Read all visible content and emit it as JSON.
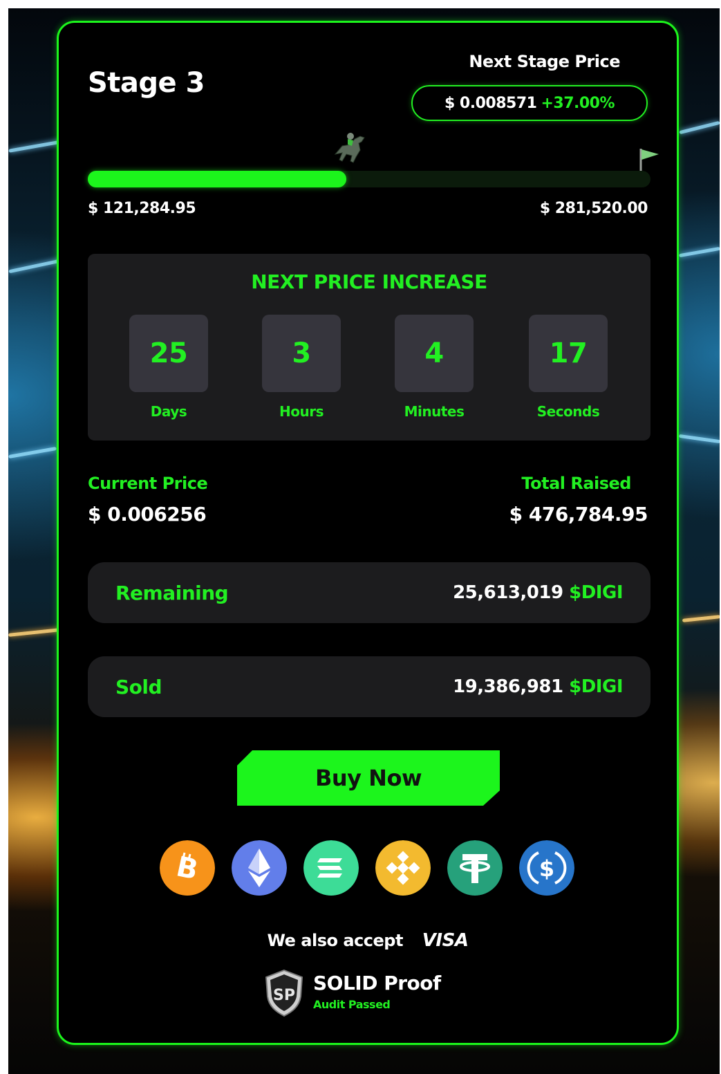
{
  "stage": {
    "title": "Stage 3"
  },
  "next_stage": {
    "label": "Next Stage Price",
    "price": "$ 0.008571",
    "change": "+37.00%"
  },
  "progress": {
    "fraction": 0.46,
    "raised_label": "$ 121,284.95",
    "target_label": "$ 281,520.00"
  },
  "countdown": {
    "title": "NEXT PRICE INCREASE",
    "units": [
      {
        "value": "25",
        "label": "Days"
      },
      {
        "value": "3",
        "label": "Hours"
      },
      {
        "value": "4",
        "label": "Minutes"
      },
      {
        "value": "17",
        "label": "Seconds"
      }
    ]
  },
  "current_price": {
    "label": "Current Price",
    "value": "$ 0.006256"
  },
  "total_raised": {
    "label": "Total Raised",
    "value": "$ 476,784.95"
  },
  "remaining": {
    "label": "Remaining",
    "value": "25,613,019",
    "token": "$DIGI"
  },
  "sold": {
    "label": "Sold",
    "value": "19,386,981",
    "token": "$DIGI"
  },
  "buy_button": {
    "label": "Buy Now"
  },
  "payment_coins": [
    {
      "icon": "bitcoin-icon",
      "color": "#f7931a"
    },
    {
      "icon": "ethereum-icon",
      "color": "#627eea"
    },
    {
      "icon": "solana-icon",
      "color": "#3ddc97"
    },
    {
      "icon": "bnb-icon",
      "color": "#f3ba2f"
    },
    {
      "icon": "tether-icon",
      "color": "#26a17b"
    },
    {
      "icon": "usdc-icon",
      "color": "#2775ca"
    }
  ],
  "accept": {
    "text": "We also accept",
    "visa": "VISA"
  },
  "audit": {
    "name": "SOLID Proof",
    "status": "Audit Passed"
  },
  "colors": {
    "accent": "#1cf51c",
    "card_bg": "#000000",
    "panel_bg": "#1c1c1e",
    "unit_bg": "#36353d"
  }
}
